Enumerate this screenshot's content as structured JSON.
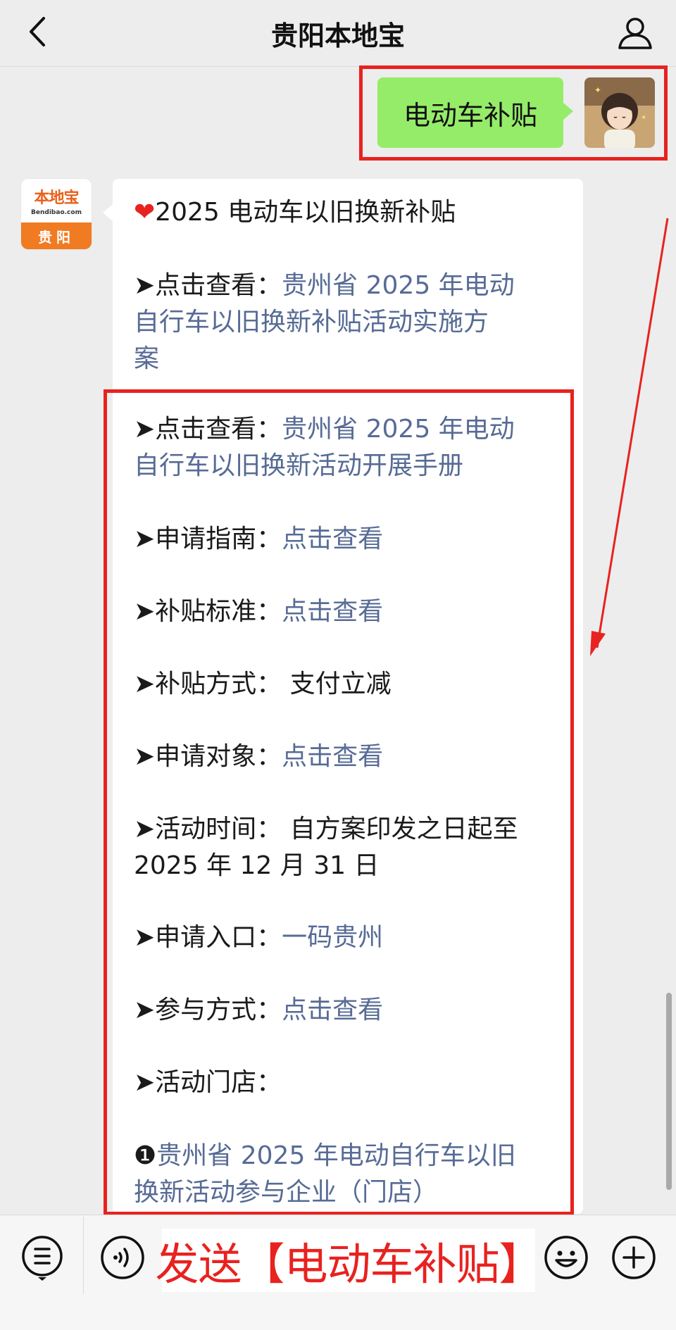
{
  "header": {
    "title": "贵阳本地宝"
  },
  "outgoing": {
    "text": "电动车补贴"
  },
  "bot": {
    "logo_text": "本地宝",
    "logo_sub": "Bendibao.com",
    "city": "贵阳"
  },
  "message": {
    "title": "2025 电动车以旧换新补贴",
    "item1_label": "➤点击查看：",
    "item1_link_line1": "贵州省 2025 年电动",
    "item1_link_line2": "自行车以旧换新补贴活动实施方",
    "item1_link_line3": "案",
    "item2_label": "➤点击查看：",
    "item2_link_line1": "贵州省 2025 年电动",
    "item2_link_line2": "自行车以旧换新活动开展手册",
    "guide_label": "➤申请指南：",
    "guide_link": "点击查看",
    "standard_label": "➤补贴标准：",
    "standard_link": "点击查看",
    "method_label": "➤补贴方式：",
    "method_value": "支付立减",
    "target_label": "➤申请对象：",
    "target_link": "点击查看",
    "time_label": "➤活动时间：",
    "time_value_line1": "自方案印发之日起至",
    "time_value_line2": "2025 年 12 月 31 日",
    "entry_label": "➤申请入口：",
    "entry_link": "一码贵州",
    "participate_label": "➤参与方式：",
    "participate_link": "点击查看",
    "stores_label": "➤活动门店：",
    "store_bullet": "❶",
    "store_link_line1": "贵州省 2025 年电动自行车以旧",
    "store_link_line2": "换新活动参与企业（门店）"
  },
  "toolbar": {
    "send_text": "发送【电动车补贴】"
  },
  "colors": {
    "highlight": "#e8221f",
    "link": "#576b95",
    "bubble_green": "#95ec69"
  }
}
